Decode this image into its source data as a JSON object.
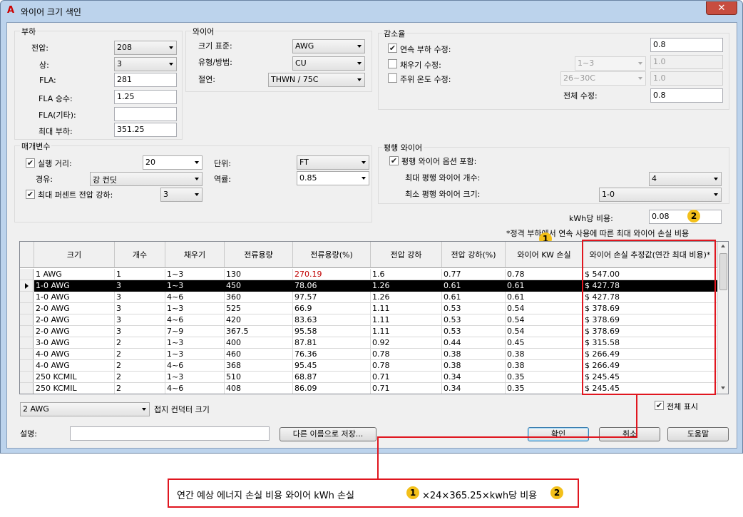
{
  "window": {
    "title": "와이어 크기 색인",
    "app_icon": "A",
    "close": "✕"
  },
  "load": {
    "group_title": "부하",
    "voltage_label": "전압:",
    "voltage": "208",
    "phase_label": "상:",
    "phase": "3",
    "fla_label": "FLA:",
    "fla": "281",
    "fla_mult_label": "FLA 승수:",
    "fla_mult": "1.25",
    "fla_other_label": "FLA(기타):",
    "fla_other": "",
    "max_load_label": "최대 부하:",
    "max_load": "351.25"
  },
  "wire": {
    "group_title": "와이어",
    "size_std_label": "크기 표준:",
    "size_std": "AWG",
    "type_label": "유형/방법:",
    "type": "CU",
    "insulation_label": "절연:",
    "insulation": "THWN / 75C"
  },
  "derate": {
    "group_title": "감소율",
    "continuous_label": "연속 부하 수정:",
    "continuous_checked": true,
    "continuous_value": "0.8",
    "fill_label": "채우기 수정:",
    "fill_checked": false,
    "fill_select": "1~3",
    "fill_value": "1.0",
    "ambient_label": "주위 온도 수정:",
    "ambient_checked": false,
    "ambient_select": "26~30C",
    "ambient_value": "1.0",
    "total_label": "전체 수정:",
    "total_value": "0.8"
  },
  "params": {
    "group_title": "매개변수",
    "run_label": "실행 거리:",
    "run_checked": true,
    "run_value": "20",
    "unit_label": "단위:",
    "unit": "FT",
    "via_label": "경유:",
    "via": "강 컨딧",
    "pf_label": "역률:",
    "pf": "0.85",
    "vdrop_label": "최대 퍼센트 전압 강하:",
    "vdrop_checked": true,
    "vdrop": "3"
  },
  "parallel": {
    "group_title": "평행 와이어",
    "include_label": "평행 와이어 옵션 포함:",
    "include_checked": true,
    "max_count_label": "최대 평행 와이어 개수:",
    "max_count": "4",
    "min_size_label": "최소 평행 와이어 크기:",
    "min_size": "1-0"
  },
  "cost": {
    "label": "kWh당 비용:",
    "value": "0.08"
  },
  "note": "*정격 부하에서 연속 사용에 따른 최대 와이어 손실 비용",
  "table": {
    "headers": [
      "크기",
      "개수",
      "채우기",
      "전류용량",
      "전류용량(%)",
      "전압 강하",
      "전압 강하(%)",
      "와이어 KW 손실",
      "와이어 손실 추정값(연간 최대 비용)*"
    ],
    "rows": [
      [
        "1 AWG",
        "1",
        "1~3",
        "130",
        "270.19",
        "1.6",
        "0.77",
        "0.78",
        "$ 547.00"
      ],
      [
        "1-0 AWG",
        "3",
        "1~3",
        "450",
        "78.06",
        "1.26",
        "0.61",
        "0.61",
        "$ 427.78"
      ],
      [
        "1-0 AWG",
        "3",
        "4~6",
        "360",
        "97.57",
        "1.26",
        "0.61",
        "0.61",
        "$ 427.78"
      ],
      [
        "2-0 AWG",
        "3",
        "1~3",
        "525",
        "66.9",
        "1.11",
        "0.53",
        "0.54",
        "$ 378.69"
      ],
      [
        "2-0 AWG",
        "3",
        "4~6",
        "420",
        "83.63",
        "1.11",
        "0.53",
        "0.54",
        "$ 378.69"
      ],
      [
        "2-0 AWG",
        "3",
        "7~9",
        "367.5",
        "95.58",
        "1.11",
        "0.53",
        "0.54",
        "$ 378.69"
      ],
      [
        "3-0 AWG",
        "2",
        "1~3",
        "400",
        "87.81",
        "0.92",
        "0.44",
        "0.45",
        "$ 315.58"
      ],
      [
        "4-0 AWG",
        "2",
        "1~3",
        "460",
        "76.36",
        "0.78",
        "0.38",
        "0.38",
        "$ 266.49"
      ],
      [
        "4-0 AWG",
        "2",
        "4~6",
        "368",
        "95.45",
        "0.78",
        "0.38",
        "0.38",
        "$ 266.49"
      ],
      [
        "250 KCMIL",
        "2",
        "1~3",
        "510",
        "68.87",
        "0.71",
        "0.34",
        "0.35",
        "$ 245.45"
      ],
      [
        "250 KCMIL",
        "2",
        "4~6",
        "408",
        "86.09",
        "0.71",
        "0.34",
        "0.35",
        "$ 245.45"
      ]
    ],
    "selected_row": 1,
    "red_cell_row": 0
  },
  "ground": {
    "value": "2 AWG",
    "label": "접지 컨덕터 크기"
  },
  "show_all": {
    "label": "전체 표시",
    "checked": true
  },
  "description_label": "설명:",
  "buttons": {
    "save_as": "다른 이름으로 저장...",
    "ok": "확인",
    "cancel": "취소",
    "help": "도움말"
  },
  "badges": {
    "one": "1",
    "two": "2"
  },
  "formula": {
    "part1": "연간 예상 에너지 손실 비용 와이어 kWh 손실",
    "part2": "×24×365.25×kwh당 비용"
  },
  "colors": {
    "annotation_red": "#e0161f",
    "badge_yellow": "#f3c01a",
    "over_value_red": "#c00000"
  }
}
